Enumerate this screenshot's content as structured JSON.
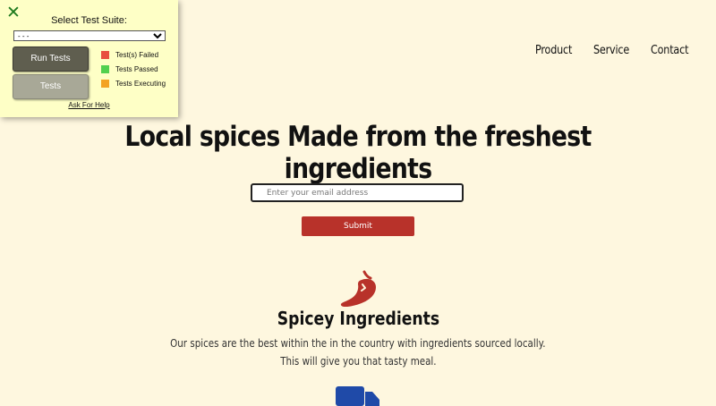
{
  "nav": {
    "items": [
      "Product",
      "Service",
      "Contact"
    ]
  },
  "hero": {
    "title": "Local spices Made from the freshest ingredients",
    "email_placeholder": "Enter your email address",
    "submit_label": "Submit"
  },
  "feature": {
    "icon": "chili-pepper-icon",
    "title": "Spicey Ingredients",
    "line1": "Our spices are the best within the in the country with ingredients sourced locally.",
    "line2": "This will give you that tasty meal.",
    "next_icon": "truck-icon"
  },
  "test_panel": {
    "close_icon": "close-icon",
    "label": "Select Test Suite:",
    "selected": "- - -",
    "run_label": "Run Tests",
    "tests_label": "Tests",
    "legend": [
      {
        "label": "Test(s) Failed",
        "color": "#e8503f"
      },
      {
        "label": "Tests Passed",
        "color": "#52d04f"
      },
      {
        "label": "Tests Executing",
        "color": "#f3a322"
      }
    ],
    "help": "Ask For Help"
  },
  "colors": {
    "background": "#fef7df",
    "accent": "#b8322a",
    "panel": "#feffc6",
    "truck": "#1f4aa8"
  }
}
